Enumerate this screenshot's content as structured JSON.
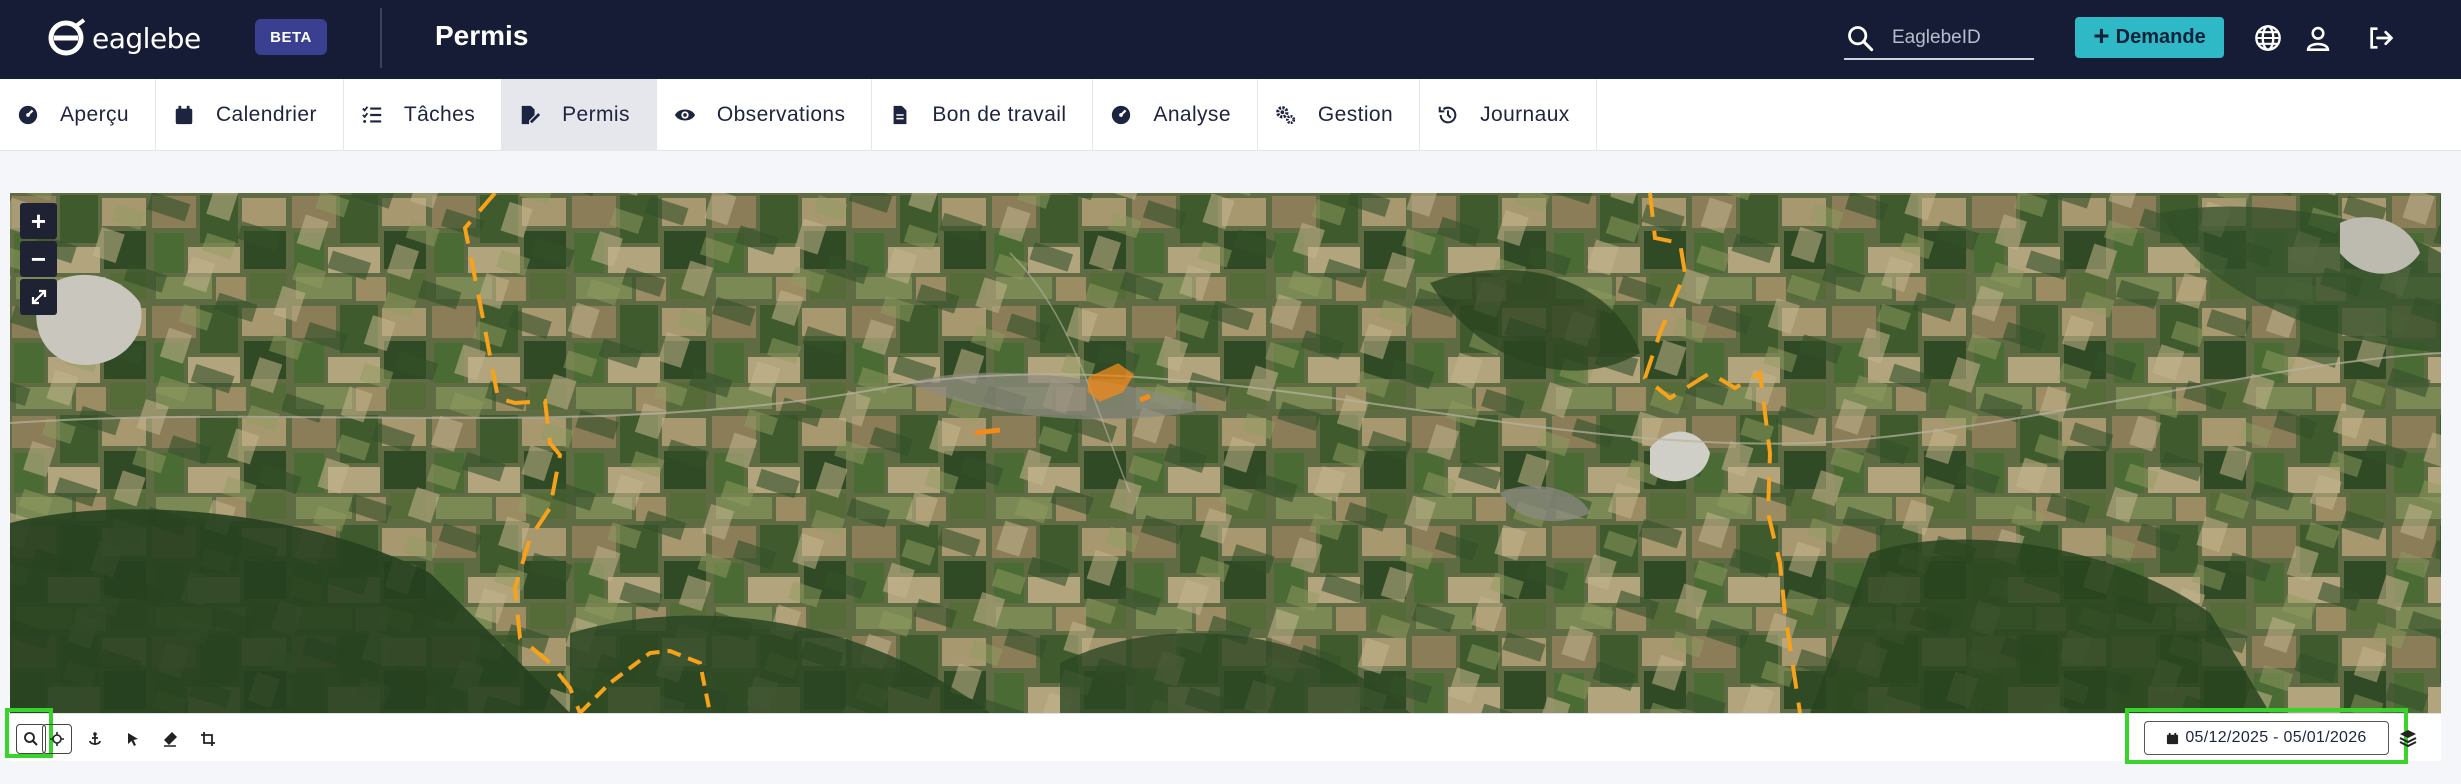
{
  "header": {
    "brand": "eaglebe",
    "badge": "BETA",
    "page_title": "Permis",
    "search_placeholder": "EaglebeID",
    "demande_label": "Demande"
  },
  "tabs": [
    {
      "label": "Aperçu",
      "icon": "gauge-icon"
    },
    {
      "label": "Calendrier",
      "icon": "calendar-icon"
    },
    {
      "label": "Tâches",
      "icon": "checklist-icon"
    },
    {
      "label": "Permis",
      "icon": "file-signature-icon",
      "active": true
    },
    {
      "label": "Observations",
      "icon": "eye-icon"
    },
    {
      "label": "Bon de travail",
      "icon": "file-icon"
    },
    {
      "label": "Analyse",
      "icon": "gauge-icon"
    },
    {
      "label": "Gestion",
      "icon": "cogs-icon"
    },
    {
      "label": "Journaux",
      "icon": "history-icon"
    }
  ],
  "map": {
    "zoom_in": "+",
    "zoom_out": "−",
    "date_range": "05/12/2025 - 05/01/2026",
    "tools": [
      "search-icon",
      "locate-icon",
      "anchor-icon",
      "pointer-icon",
      "eraser-icon",
      "crop-icon"
    ],
    "boundary_color": "#f7a21b",
    "parcel_color": "#f28a1c"
  },
  "colors": {
    "header_bg": "#161c36",
    "accent": "#2fb8c6",
    "badge_bg": "#3b3f8f",
    "highlight": "#39d42b"
  }
}
